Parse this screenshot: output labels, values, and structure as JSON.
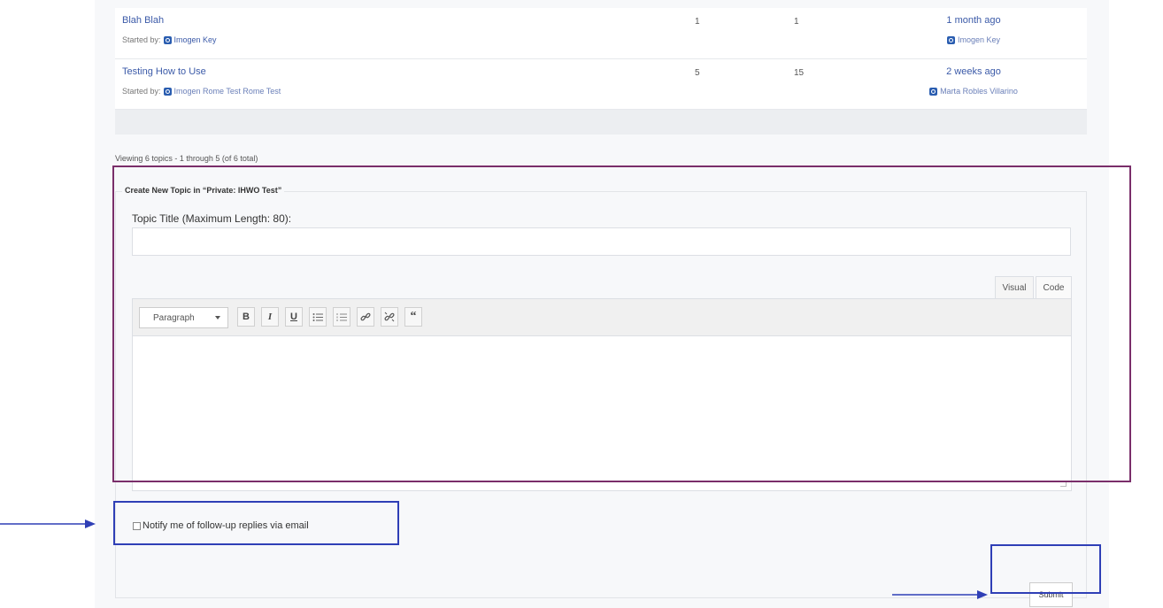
{
  "topics": [
    {
      "title": "Blah Blah",
      "started_by_label": "Started by:",
      "author": "Imogen Key",
      "voices": "1",
      "posts": "1",
      "freshness": "1 month ago",
      "last_author": "Imogen Key"
    },
    {
      "title": "Testing How to Use",
      "started_by_label": "Started by:",
      "author": "Imogen Rome Test Rome Test",
      "voices": "5",
      "posts": "15",
      "freshness": "2 weeks ago",
      "last_author": "Marta Robles Villarino"
    }
  ],
  "pagination_text": "Viewing 6 topics - 1 through 5 (of 6 total)",
  "form": {
    "legend": "Create New Topic in “Private: IHWO Test”",
    "title_label": "Topic Title (Maximum Length: 80):",
    "title_value": "",
    "tabs": {
      "visual": "Visual",
      "code": "Code"
    },
    "format_select": "Paragraph",
    "toolbar_buttons": [
      "bold-icon",
      "italic-icon",
      "underline-icon",
      "bullet-list-icon",
      "numbered-list-icon",
      "link-icon",
      "unlink-icon",
      "blockquote-icon"
    ],
    "notify_label": "Notify me of follow-up replies via email",
    "submit_label": "Submit"
  },
  "colors": {
    "link": "#3b5aa8",
    "highlight_purple": "#7a2e6a",
    "highlight_blue": "#2f3fb6"
  }
}
